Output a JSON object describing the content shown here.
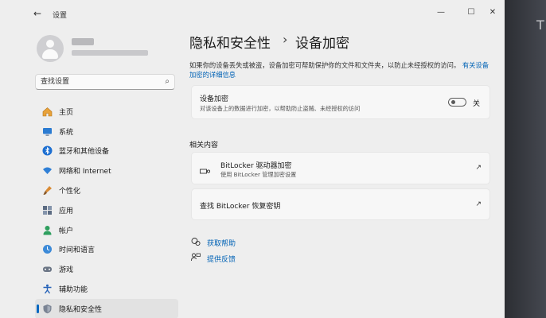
{
  "window": {
    "app_title": "设置"
  },
  "search": {
    "placeholder": "查找设置"
  },
  "nav": {
    "items": [
      {
        "label": "主页",
        "icon": "home-icon"
      },
      {
        "label": "系统",
        "icon": "monitor-icon"
      },
      {
        "label": "蓝牙和其他设备",
        "icon": "bluetooth-icon"
      },
      {
        "label": "网络和 Internet",
        "icon": "wifi-icon"
      },
      {
        "label": "个性化",
        "icon": "brush-icon"
      },
      {
        "label": "应用",
        "icon": "apps-icon"
      },
      {
        "label": "帐户",
        "icon": "person-icon"
      },
      {
        "label": "时间和语言",
        "icon": "globe-clock-icon"
      },
      {
        "label": "游戏",
        "icon": "gamepad-icon"
      },
      {
        "label": "辅助功能",
        "icon": "accessibility-icon"
      },
      {
        "label": "隐私和安全性",
        "icon": "shield-icon"
      }
    ],
    "selected": "隐私和安全性"
  },
  "breadcrumb": {
    "parent": "隐私和安全性",
    "current": "设备加密"
  },
  "description": {
    "text": "如果你的设备丢失或被盗，设备加密可帮助保护你的文件和文件夹，以防止未经授权的访问。",
    "link": "有关设备加密的详细信息"
  },
  "encryption_card": {
    "title": "设备加密",
    "subtitle": "对该设备上的数据进行加密，以帮助防止盗贼、未经授权的访问",
    "toggle_label": "关",
    "toggle_on": false
  },
  "related": {
    "heading": "相关内容",
    "bitlocker_title": "BitLocker 驱动器加密",
    "bitlocker_sub": "使用 BitLocker 管理加密设置",
    "recovery_label": "查找 BitLocker 恢复密钥"
  },
  "help": {
    "get_help": "获取帮助",
    "feedback": "提供反馈"
  },
  "colors": {
    "accent": "#0067c0",
    "link": "#0062b5",
    "window_bg": "#eeeeee"
  }
}
